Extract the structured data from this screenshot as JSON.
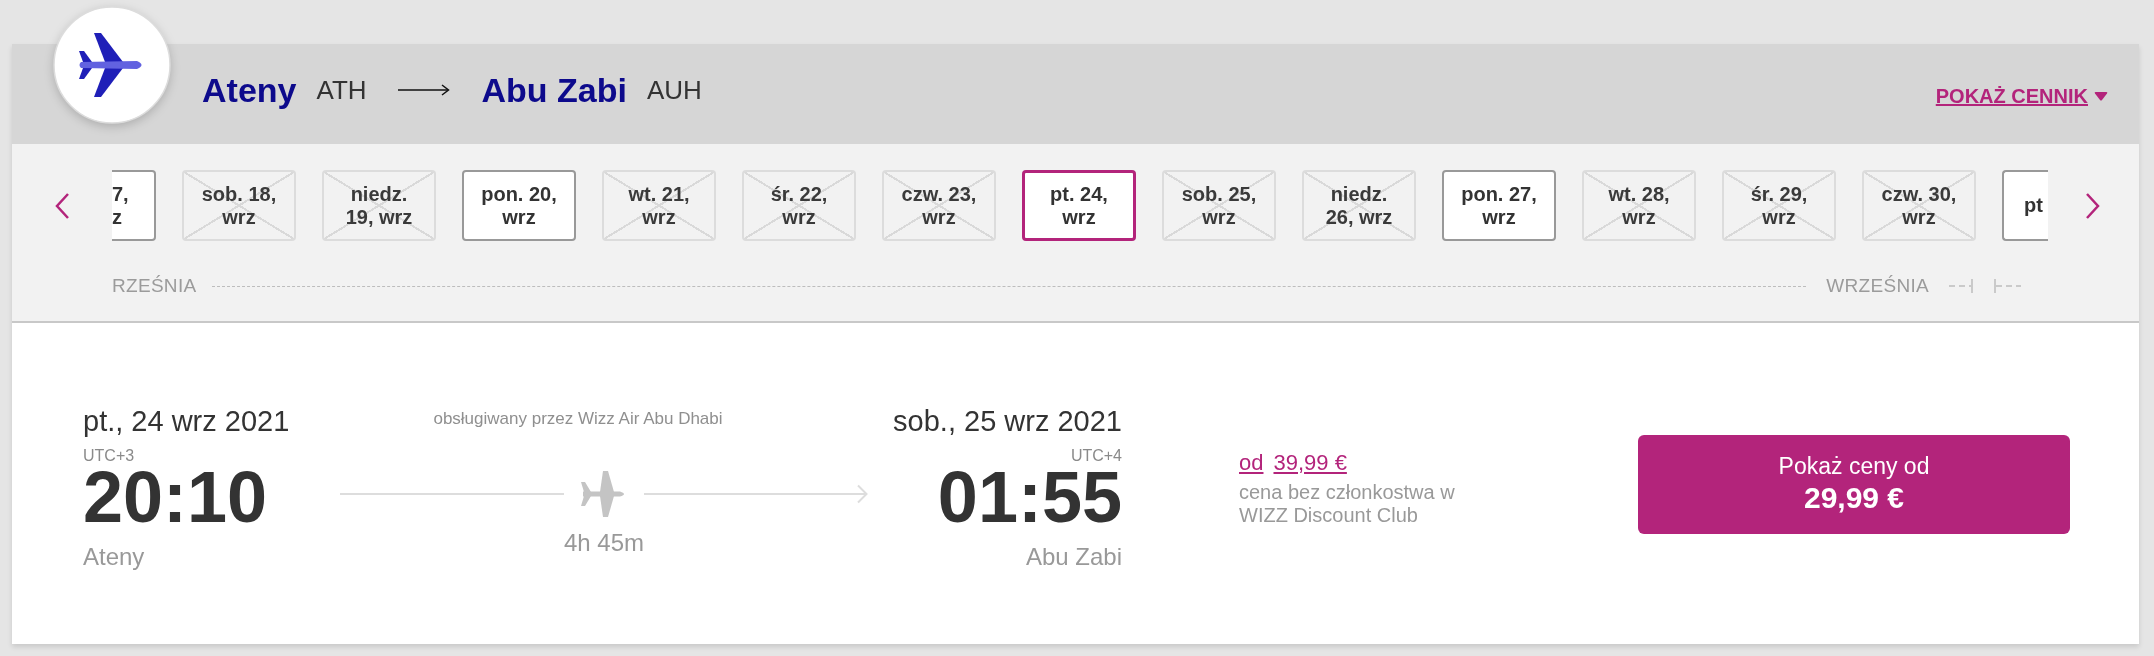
{
  "route": {
    "origin": {
      "city": "Ateny",
      "code": "ATH"
    },
    "destination": {
      "city": "Abu Zabi",
      "code": "AUH"
    },
    "fare_link": "POKAŻ CENNIK"
  },
  "date_strip": {
    "dates": [
      {
        "label": "7,\nz",
        "kind": "clipped-start",
        "disabled": false,
        "selected": false
      },
      {
        "label": "sob. 18,\nwrz",
        "kind": "full",
        "disabled": true,
        "selected": false
      },
      {
        "label": "niedz.\n19, wrz",
        "kind": "full",
        "disabled": true,
        "selected": false
      },
      {
        "label": "pon. 20,\nwrz",
        "kind": "full",
        "disabled": false,
        "selected": false
      },
      {
        "label": "wt. 21,\nwrz",
        "kind": "full",
        "disabled": true,
        "selected": false
      },
      {
        "label": "śr. 22,\nwrz",
        "kind": "full",
        "disabled": true,
        "selected": false
      },
      {
        "label": "czw. 23,\nwrz",
        "kind": "full",
        "disabled": true,
        "selected": false
      },
      {
        "label": "pt. 24,\nwrz",
        "kind": "full",
        "disabled": false,
        "selected": true
      },
      {
        "label": "sob. 25,\nwrz",
        "kind": "full",
        "disabled": true,
        "selected": false
      },
      {
        "label": "niedz.\n26, wrz",
        "kind": "full",
        "disabled": true,
        "selected": false
      },
      {
        "label": "pon. 27,\nwrz",
        "kind": "full",
        "disabled": false,
        "selected": false
      },
      {
        "label": "wt. 28,\nwrz",
        "kind": "full",
        "disabled": true,
        "selected": false
      },
      {
        "label": "śr. 29,\nwrz",
        "kind": "full",
        "disabled": true,
        "selected": false
      },
      {
        "label": "czw. 30,\nwrz",
        "kind": "full",
        "disabled": true,
        "selected": false
      },
      {
        "label": "pt",
        "kind": "clipped-end",
        "disabled": false,
        "selected": false
      }
    ],
    "months": [
      "RZEŚNIA",
      "WRZEŚNIA"
    ]
  },
  "flight": {
    "departure": {
      "date": "pt., 24 wrz 2021",
      "timezone": "UTC+3",
      "time": "20:10",
      "city": "Ateny"
    },
    "operator": "obsługiwany przez Wizz Air Abu Dhabi",
    "duration": "4h 45m",
    "arrival": {
      "date": "sob., 25 wrz 2021",
      "timezone": "UTC+4",
      "time": "01:55",
      "city": "Abu Zabi"
    }
  },
  "price": {
    "prefix": "od",
    "amount": "39,99 €",
    "note": "cena bez członkostwa w WIZZ Discount Club"
  },
  "cta": {
    "label": "Pokaż ceny od",
    "price": "29,99 €"
  }
}
